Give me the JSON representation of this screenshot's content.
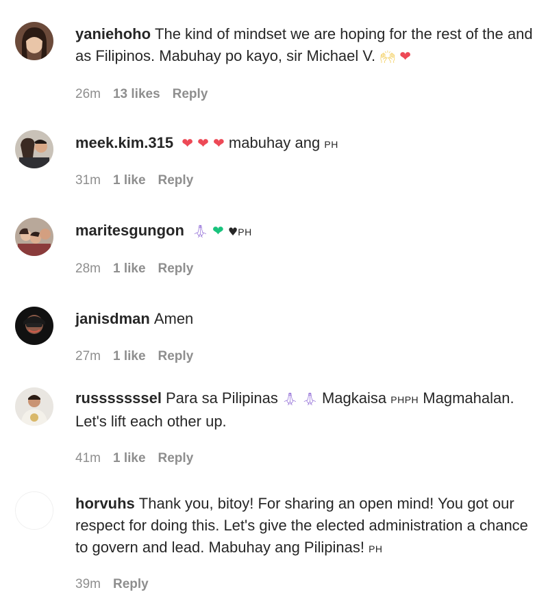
{
  "comments": [
    {
      "username": "yaniehoho",
      "text_a": "The kind of mindset we are hoping for the rest of the and as Filipinos. Mabuhay po kayo, sir Michael V.",
      "time": "26m",
      "likes": "13 likes",
      "reply": "Reply"
    },
    {
      "username": "meek.kim.315",
      "text_a": "mabuhay ang",
      "flag": "PH",
      "time": "31m",
      "likes": "1 like",
      "reply": "Reply"
    },
    {
      "username": "maritesgungon",
      "flag": "PH",
      "time": "28m",
      "likes": "1 like",
      "reply": "Reply"
    },
    {
      "username": "janisdman",
      "text_a": "Amen",
      "time": "27m",
      "likes": "1 like",
      "reply": "Reply"
    },
    {
      "username": "russsssssel",
      "text_a": "Para sa Pilipinas",
      "text_b": "Magkaisa",
      "flag": "PHPH",
      "text_c": "Magmahalan. Let's lift each other up.",
      "time": "41m",
      "likes": "1 like",
      "reply": "Reply"
    },
    {
      "username": "horvuhs",
      "text_a": "Thank you, bitoy! For sharing an open mind! You got our respect for doing this. Let's give the elected administration a chance to govern and lead. Mabuhay ang Pilipinas!",
      "flag": "PH",
      "time": "39m",
      "reply": "Reply"
    }
  ],
  "icons": {
    "heart_red": "red-heart-icon",
    "heart_green": "green-heart-icon",
    "heart_black": "black-heart-icon",
    "pray": "praying-hands-icon",
    "raised_hands": "raising-hands-icon"
  },
  "colors": {
    "text": "#262626",
    "meta": "#8e8e8e",
    "heart_red": "#ed4956",
    "heart_green": "#19c37d",
    "pray": "#8f6ad6"
  }
}
